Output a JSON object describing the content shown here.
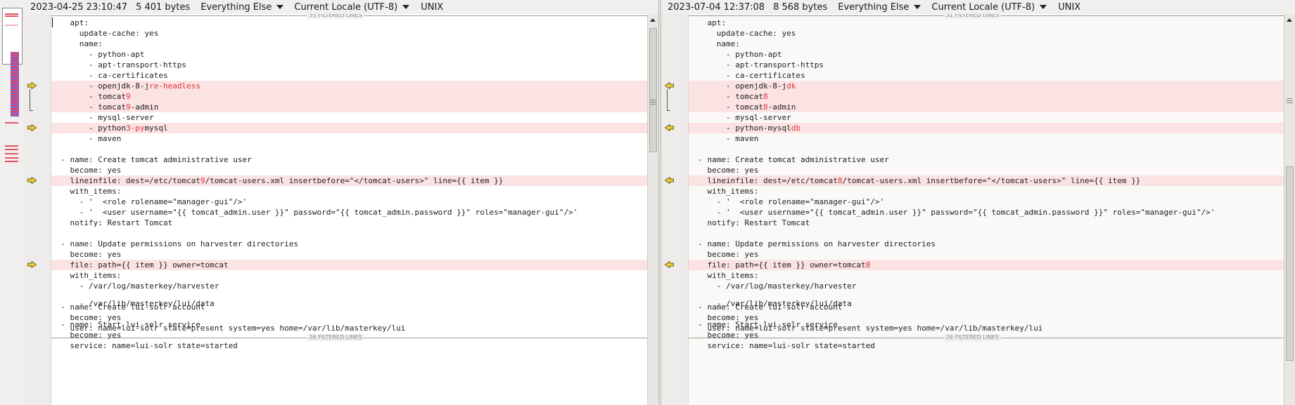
{
  "left": {
    "timestamp": "2023-04-25 23:10:47",
    "size": "5 401 bytes",
    "filter_mode": "Everything Else",
    "encoding": "Current Locale (UTF-8)",
    "eol": "UNIX"
  },
  "right": {
    "timestamp": "2023-07-04 12:37:08",
    "size": "8 568 bytes",
    "filter_mode": "Everything Else",
    "encoding": "Current Locale (UTF-8)",
    "eol": "UNIX"
  },
  "filtered": {
    "top": "31 FILTERED LINES",
    "middle": "26 FILTERED LINES"
  },
  "lines_a": [
    {
      "indent": "      ",
      "segs": [
        [
          "apt:",
          0
        ]
      ]
    },
    {
      "indent": "        ",
      "segs": [
        [
          "update-cache: yes",
          0
        ]
      ]
    },
    {
      "indent": "        ",
      "segs": [
        [
          "name:",
          0
        ]
      ]
    },
    {
      "indent": "          ",
      "segs": [
        [
          "- python-apt",
          0
        ]
      ]
    },
    {
      "indent": "          ",
      "segs": [
        [
          "- apt-transport-https",
          0
        ]
      ]
    },
    {
      "indent": "          ",
      "segs": [
        [
          "- ca-certificates",
          0
        ]
      ]
    }
  ],
  "left_lines": [
    {
      "d": 0,
      "segs": [
        [
          "    apt:",
          0
        ]
      ]
    },
    {
      "d": 0,
      "segs": [
        [
          "      update-cache: yes",
          0
        ]
      ]
    },
    {
      "d": 0,
      "segs": [
        [
          "      name:",
          0
        ]
      ]
    },
    {
      "d": 0,
      "segs": [
        [
          "        - python-apt",
          0
        ]
      ]
    },
    {
      "d": 0,
      "segs": [
        [
          "        - apt-transport-https",
          0
        ]
      ]
    },
    {
      "d": 0,
      "segs": [
        [
          "        - ca-certificates",
          0
        ]
      ]
    },
    {
      "d": 1,
      "segs": [
        [
          "        - openjdk-8-j",
          0
        ],
        [
          "re-headless",
          1
        ]
      ]
    },
    {
      "d": 1,
      "segs": [
        [
          "        - tomcat",
          0
        ],
        [
          "9",
          1
        ]
      ]
    },
    {
      "d": 1,
      "segs": [
        [
          "        - tomcat",
          0
        ],
        [
          "9",
          1
        ],
        [
          "-admin",
          0
        ]
      ]
    },
    {
      "d": 0,
      "segs": [
        [
          "        - mysql-server",
          0
        ]
      ]
    },
    {
      "d": 1,
      "segs": [
        [
          "        - python",
          0
        ],
        [
          "3-py",
          1
        ],
        [
          "mysql",
          0
        ]
      ]
    },
    {
      "d": 0,
      "segs": [
        [
          "        - maven",
          0
        ]
      ]
    },
    {
      "d": 0,
      "segs": [
        [
          "",
          0
        ]
      ]
    },
    {
      "d": 0,
      "segs": [
        [
          "  - name: Create tomcat administrative user",
          0
        ]
      ]
    },
    {
      "d": 0,
      "segs": [
        [
          "    become: yes",
          0
        ]
      ]
    },
    {
      "d": 1,
      "segs": [
        [
          "    lineinfile: dest=/etc/tomcat",
          0
        ],
        [
          "9",
          1
        ],
        [
          "/tomcat-users.xml insertbefore=\"</tomcat-users>\" line={{ item }}",
          0
        ]
      ]
    },
    {
      "d": 0,
      "segs": [
        [
          "    with_items:",
          0
        ]
      ]
    },
    {
      "d": 0,
      "segs": [
        [
          "      - '  <role rolename=\"manager-gui\"/>'",
          0
        ]
      ]
    },
    {
      "d": 0,
      "segs": [
        [
          "      - '  <user username=\"{{ tomcat_admin.user }}\" password=\"{{ tomcat_admin.password }}\" roles=\"manager-gui\"/>'",
          0
        ]
      ]
    },
    {
      "d": 0,
      "segs": [
        [
          "    notify: Restart Tomcat",
          0
        ]
      ]
    },
    {
      "d": 0,
      "segs": [
        [
          "",
          0
        ]
      ]
    },
    {
      "d": 0,
      "segs": [
        [
          "  - name: Update permissions on harvester directories",
          0
        ]
      ]
    },
    {
      "d": 0,
      "segs": [
        [
          "    become: yes",
          0
        ]
      ]
    },
    {
      "d": 1,
      "segs": [
        [
          "    file: path={{ item }} owner=tomcat",
          0
        ]
      ]
    },
    {
      "d": 0,
      "segs": [
        [
          "    with_items:",
          0
        ]
      ]
    },
    {
      "d": 0,
      "segs": [
        [
          "      - /var/log/masterkey/harvester",
          0
        ]
      ]
    },
    {
      "d": 0,
      "segs": [
        [
          "",
          0
        ]
      ]
    },
    {
      "d": 0,
      "segs": [
        [
          "  - name: Create lui-solr account",
          0
        ]
      ]
    },
    {
      "d": 0,
      "segs": [
        [
          "    become: yes",
          0
        ]
      ]
    },
    {
      "d": 0,
      "segs": [
        [
          "    user: name=lui-solr state=present system=yes home=/var/lib/masterkey/lui",
          0
        ]
      ]
    }
  ],
  "right_lines": [
    {
      "d": 0,
      "segs": [
        [
          "    apt:",
          0
        ]
      ]
    },
    {
      "d": 0,
      "segs": [
        [
          "      update-cache: yes",
          0
        ]
      ]
    },
    {
      "d": 0,
      "segs": [
        [
          "      name:",
          0
        ]
      ]
    },
    {
      "d": 0,
      "segs": [
        [
          "        - python-apt",
          0
        ]
      ]
    },
    {
      "d": 0,
      "segs": [
        [
          "        - apt-transport-https",
          0
        ]
      ]
    },
    {
      "d": 0,
      "segs": [
        [
          "        - ca-certificates",
          0
        ]
      ]
    },
    {
      "d": 1,
      "segs": [
        [
          "        - openjdk-8-j",
          0
        ],
        [
          "dk",
          1
        ]
      ]
    },
    {
      "d": 1,
      "segs": [
        [
          "        - tomcat",
          0
        ],
        [
          "8",
          1
        ]
      ]
    },
    {
      "d": 1,
      "segs": [
        [
          "        - tomcat",
          0
        ],
        [
          "8",
          1
        ],
        [
          "-admin",
          0
        ]
      ]
    },
    {
      "d": 0,
      "segs": [
        [
          "        - mysql-server",
          0
        ]
      ]
    },
    {
      "d": 1,
      "segs": [
        [
          "        - python-mysql",
          0
        ],
        [
          "db",
          1
        ]
      ]
    },
    {
      "d": 0,
      "segs": [
        [
          "        - maven",
          0
        ]
      ]
    },
    {
      "d": 0,
      "segs": [
        [
          "",
          0
        ]
      ]
    },
    {
      "d": 0,
      "segs": [
        [
          "  - name: Create tomcat administrative user",
          0
        ]
      ]
    },
    {
      "d": 0,
      "segs": [
        [
          "    become: yes",
          0
        ]
      ]
    },
    {
      "d": 1,
      "segs": [
        [
          "    lineinfile: dest=/etc/tomcat",
          0
        ],
        [
          "8",
          1
        ],
        [
          "/tomcat-users.xml insertbefore=\"</tomcat-users>\" line={{ item }}",
          0
        ]
      ]
    },
    {
      "d": 0,
      "segs": [
        [
          "    with_items:",
          0
        ]
      ]
    },
    {
      "d": 0,
      "segs": [
        [
          "      - '  <role rolename=\"manager-gui\"/>'",
          0
        ]
      ]
    },
    {
      "d": 0,
      "segs": [
        [
          "      - '  <user username=\"{{ tomcat_admin.user }}\" password=\"{{ tomcat_admin.password }}\" roles=\"manager-gui\"/>'",
          0
        ]
      ]
    },
    {
      "d": 0,
      "segs": [
        [
          "    notify: Restart Tomcat",
          0
        ]
      ]
    },
    {
      "d": 0,
      "segs": [
        [
          "",
          0
        ]
      ]
    },
    {
      "d": 0,
      "segs": [
        [
          "  - name: Update permissions on harvester directories",
          0
        ]
      ]
    },
    {
      "d": 0,
      "segs": [
        [
          "    become: yes",
          0
        ]
      ]
    },
    {
      "d": 1,
      "segs": [
        [
          "    file: path={{ item }} owner=tomcat",
          0
        ],
        [
          "8",
          1
        ]
      ]
    },
    {
      "d": 0,
      "segs": [
        [
          "    with_items:",
          0
        ]
      ]
    },
    {
      "d": 0,
      "segs": [
        [
          "      - /var/log/masterkey/harvester",
          0
        ]
      ]
    },
    {
      "d": 0,
      "segs": [
        [
          "",
          0
        ]
      ]
    },
    {
      "d": 0,
      "segs": [
        [
          "  - name: Create lui-solr account",
          0
        ]
      ]
    },
    {
      "d": 0,
      "segs": [
        [
          "    become: yes",
          0
        ]
      ]
    },
    {
      "d": 0,
      "segs": [
        [
          "    user: name=lui-solr state=present system=yes home=/var/lib/masterkey/lui",
          0
        ]
      ]
    }
  ],
  "tail_lines": [
    [
      [
        "      - /var/lib/masterkey/lui/data",
        0
      ]
    ],
    [
      [
        "",
        0
      ]
    ],
    [
      [
        "  - name: Start lui-solr service",
        0
      ]
    ],
    [
      [
        "    become: yes",
        0
      ]
    ],
    [
      [
        "    service: name=lui-solr state=started",
        0
      ]
    ]
  ],
  "colors": {
    "diff_bg": "#fbe2e3",
    "changed_text": "#e0363e",
    "arrow_fill": "#f2d23a"
  },
  "icons": [
    "copy-right-arrow-icon",
    "copy-left-arrow-icon",
    "plus-expand-icon",
    "scroll-up-icon"
  ]
}
